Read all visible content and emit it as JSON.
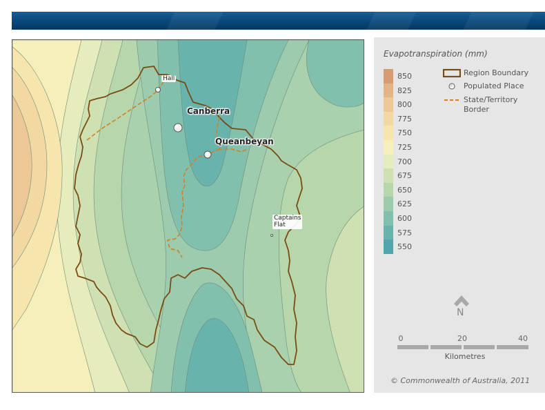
{
  "legend": {
    "title": "Evapotranspiration (mm)",
    "ramp": [
      {
        "label": "850",
        "color": "#d89c72"
      },
      {
        "label": "825",
        "color": "#e3b487"
      },
      {
        "label": "800",
        "color": "#ecc896"
      },
      {
        "label": "775",
        "color": "#f2d9a2"
      },
      {
        "label": "750",
        "color": "#f6e6ad"
      },
      {
        "label": "725",
        "color": "#f5efba"
      },
      {
        "label": "700",
        "color": "#e6ecbc"
      },
      {
        "label": "675",
        "color": "#cfe1b2"
      },
      {
        "label": "650",
        "color": "#b6d6ac"
      },
      {
        "label": "625",
        "color": "#9ccbae"
      },
      {
        "label": "600",
        "color": "#82c0ae"
      },
      {
        "label": "575",
        "color": "#69b3ad"
      },
      {
        "label": "550",
        "color": "#52a6ab"
      }
    ],
    "symbols": {
      "region_boundary": "Region Boundary",
      "populated_place": "Populated Place",
      "border": "State/Territory\nBorder"
    },
    "north": "N",
    "scale": {
      "ticks": [
        "0",
        "20",
        "40"
      ],
      "unit": "Kilometres"
    },
    "copyright": "© Commonwealth of Australia, 2011"
  },
  "places": {
    "hall": "Hall",
    "canberra": "Canberra",
    "queanbeyan": "Queanbeyan",
    "captains_flat": "Captains\nFlat"
  },
  "colors": {
    "boundary": "#7a4a10",
    "border": "#d77f1e",
    "banner": "#0b4a7e",
    "panel": "#e6e6e6"
  }
}
